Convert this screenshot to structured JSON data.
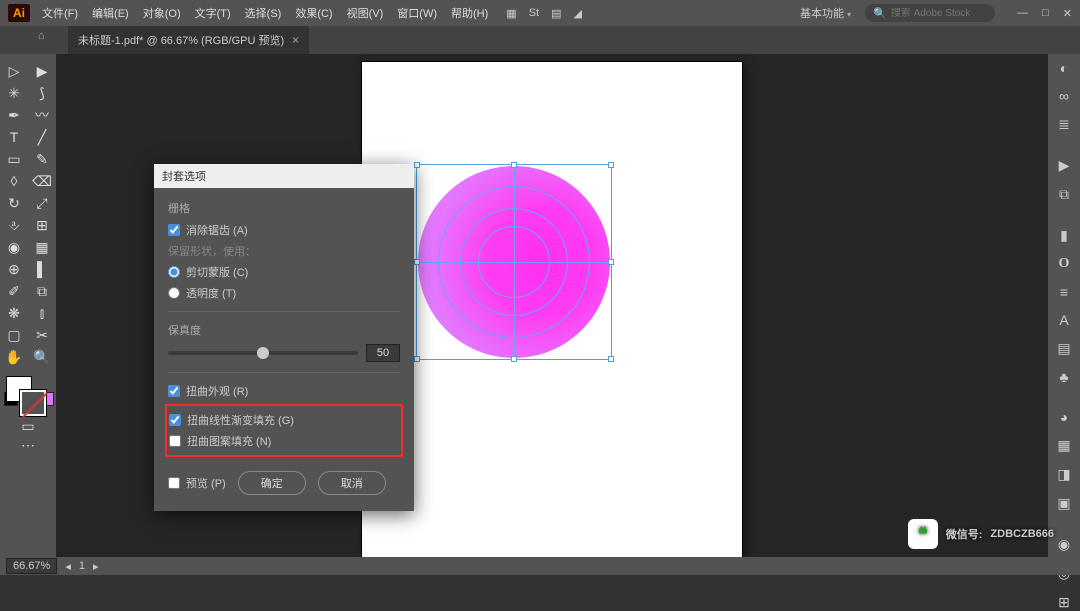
{
  "app": {
    "logo": "Ai"
  },
  "menu": [
    "文件(F)",
    "编辑(E)",
    "对象(O)",
    "文字(T)",
    "选择(S)",
    "效果(C)",
    "视图(V)",
    "窗口(W)",
    "帮助(H)"
  ],
  "titlebar": {
    "workspace": "基本功能",
    "search_placeholder": "搜索 Adobe Stock",
    "win_min": "—",
    "win_max": "□",
    "win_close": "✕"
  },
  "document": {
    "tab_title": "未标题-1.pdf* @ 66.67% (RGB/GPU 预览)",
    "tab_close": "×"
  },
  "dialog": {
    "title": "封套选项",
    "section_raster": "栅格",
    "antialias": "消除锯齿 (A)",
    "preserve_label": "保留形状，使用：",
    "clip_mask": "剪切蒙版 (C)",
    "transparency": "透明度 (T)",
    "fidelity_label": "保真度",
    "fidelity_value": "50",
    "distort_appearance": "扭曲外观 (R)",
    "distort_gradient": "扭曲线性渐变填充 (G)",
    "distort_pattern": "扭曲图案填充 (N)",
    "preview": "预览 (P)",
    "ok": "确定",
    "cancel": "取消"
  },
  "status": {
    "zoom": "66.67%",
    "nav": "1"
  },
  "watermark": {
    "label": "微信号:",
    "id": "ZDBCZB666"
  },
  "mini_colors": [
    "#000",
    "#fff",
    "#e076ff"
  ]
}
